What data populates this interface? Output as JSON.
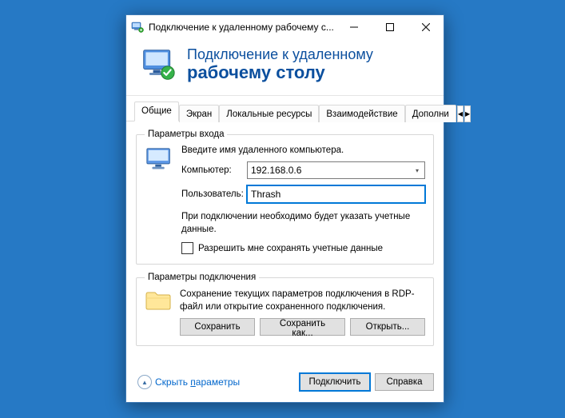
{
  "titlebar": {
    "text": "Подключение к удаленному рабочему с..."
  },
  "banner": {
    "line1": "Подключение к удаленному",
    "line2": "рабочему столу"
  },
  "tabs": {
    "t0": "Общие",
    "t1": "Экран",
    "t2": "Локальные ресурсы",
    "t3": "Взаимодействие",
    "t4": "Дополни"
  },
  "login": {
    "legend": "Параметры входа",
    "intro": "Введите имя удаленного компьютера.",
    "computer_label": "Компьютер:",
    "computer_value": "192.168.0.6",
    "user_label": "Пользователь:",
    "user_value": "Thrash",
    "note": "При подключении необходимо будет указать учетные данные.",
    "checkbox": "Разрешить мне сохранять учетные данные"
  },
  "conn": {
    "legend": "Параметры подключения",
    "text": "Сохранение текущих параметров подключения в RDP-файл или открытие сохраненного подключения.",
    "save": "Сохранить",
    "save_as": "Сохранить как...",
    "open": "Открыть..."
  },
  "footer": {
    "hide_prefix": "Скрыть ",
    "hide_underlined": "п",
    "hide_suffix": "араметры",
    "connect": "Подключить",
    "help": "Справка"
  }
}
